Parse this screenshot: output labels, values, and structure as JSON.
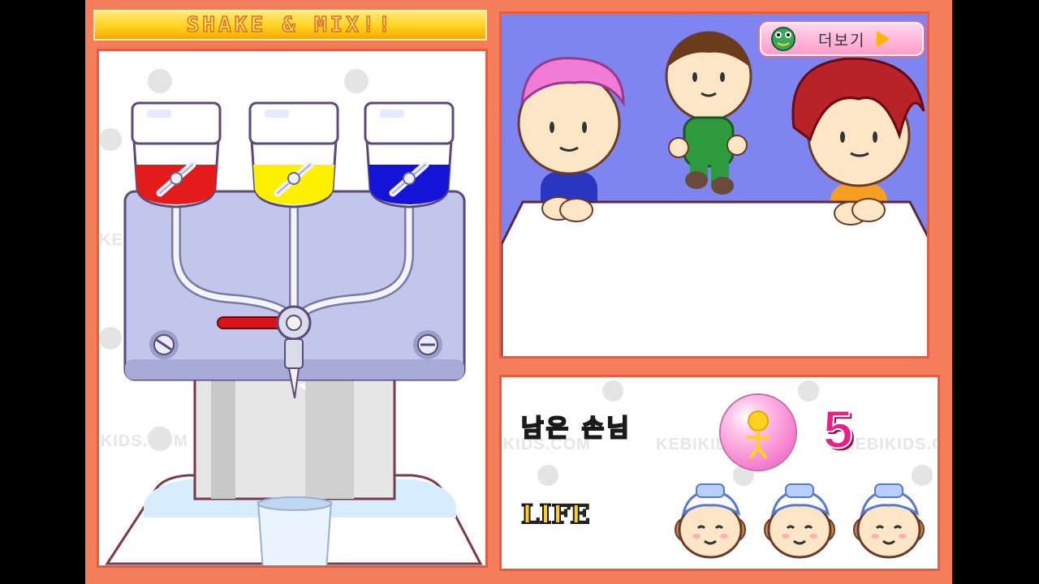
{
  "game": {
    "title": "SHAKE & MIX!!",
    "watermark": "KEBIKIDS.COM"
  },
  "dispenser": {
    "bottles": [
      {
        "name": "red",
        "color": "#e31b1b"
      },
      {
        "name": "yellow",
        "color": "#ffef00"
      },
      {
        "name": "blue",
        "color": "#1414d8"
      }
    ],
    "lever_color": "#d8141a"
  },
  "scene": {
    "more_button_label": "더보기",
    "background_color": "#7f85f0"
  },
  "status": {
    "remaining_customers_label": "남은 손님",
    "remaining_customers_count": "5",
    "life_label": "LIFE",
    "lives": 3
  }
}
